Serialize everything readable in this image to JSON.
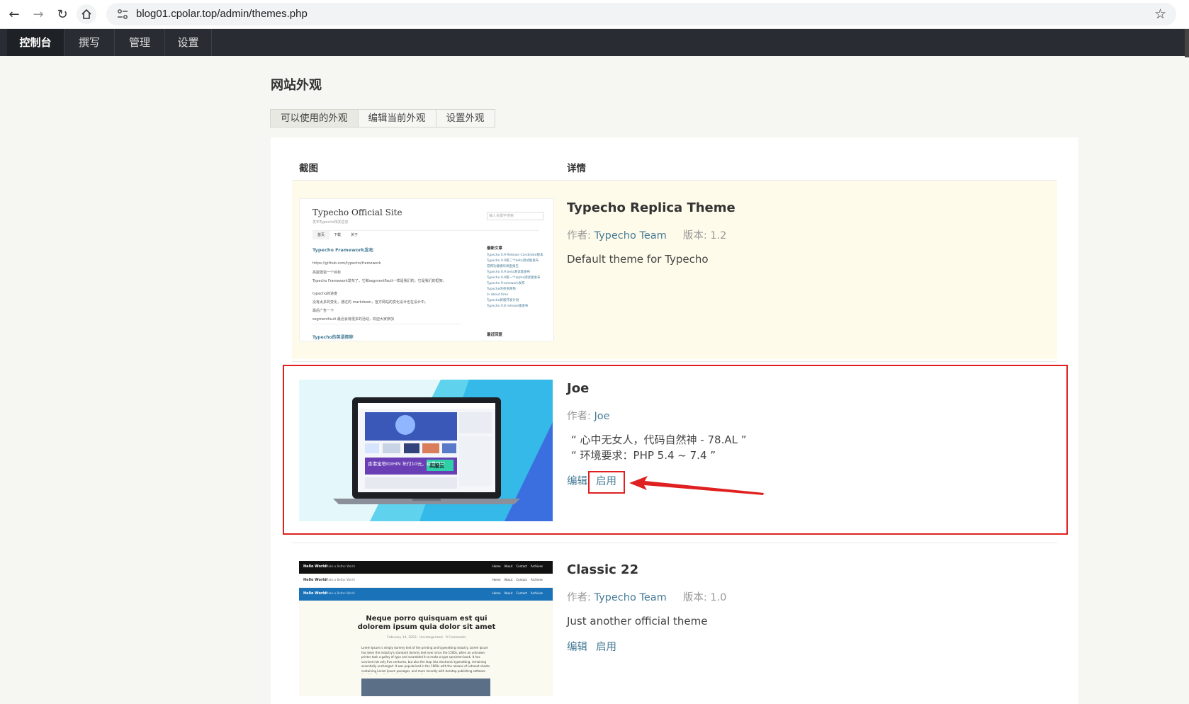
{
  "browser": {
    "url": "blog01.cpolar.top/admin/themes.php"
  },
  "admin_menu": {
    "items": [
      {
        "label": "控制台",
        "active": true
      },
      {
        "label": "撰写",
        "active": false
      },
      {
        "label": "管理",
        "active": false
      },
      {
        "label": "设置",
        "active": false
      }
    ]
  },
  "page": {
    "title": "网站外观",
    "tabs": [
      {
        "label": "可以使用的外观",
        "active": true
      },
      {
        "label": "编辑当前外观",
        "active": false
      },
      {
        "label": "设置外观",
        "active": false
      }
    ]
  },
  "table": {
    "col_screenshot": "截图",
    "col_details": "详情",
    "author_prefix": "作者: ",
    "version_prefix": "版本: ",
    "edit_label": "编辑",
    "enable_label": "启用",
    "themes": [
      {
        "name": "Typecho Replica Theme",
        "author": "Typecho Team",
        "version": "1.2",
        "description": "Default theme for Typecho",
        "current": true
      },
      {
        "name": "Joe",
        "author": "Joe",
        "description_line1": "“ 心中无女人，代码自然神 - 78.AL ”",
        "description_line2": "“ 环境要求：PHP 5.4 ~ 7.4 ”"
      },
      {
        "name": "Classic 22",
        "author": "Typecho Team",
        "version": "1.0",
        "description": "Just another official theme"
      }
    ]
  },
  "thumbnails": {
    "typecho": {
      "site_title": "Typecho Official Site",
      "subtitle": "发布Typecho相关信息",
      "search_placeholder": "输入关键字搜索",
      "nav": [
        "首页",
        "下载",
        "关于"
      ],
      "post_title": "Typecho Framework发布",
      "post_url": "https://github.com/typecho/framework",
      "post_line1": "高屋建瓴一个目标",
      "post_line2": "Typecho Framework发布了，它和segmentFault一样是我们的，它是我们的框架。",
      "post_line3": "typecho的进度",
      "post_line4": "没有太多的变化，通过的 markdown，官方网站的变化设计也在设计中。",
      "post_line5": "最后广告一下",
      "post_line6": "segmentfault 最近会有很多的活动，欢迎大家参加",
      "post_title2": "Typecho的英语简称",
      "sidebar_title": "最新文章",
      "sidebar_items": [
        "Typecho 0.9 Release Candidate版本发布",
        "Typecho 0.9第二个beta测试版发布",
        "官网功能模块调查报告",
        "Typecho 0.9 beta测试版发布",
        "Typecho 0.9第一个alpha测试版发布",
        "Typecho Framework发布",
        "Typecho的英语简称",
        "In about time",
        "Typecho新版开发计划",
        "Typecho 0.8 release版发布"
      ],
      "sidebar_title2": "最近回复"
    },
    "joe": {
      "banner_text": "香港宝塔IGIHIN 年付10元，续费同价",
      "banner_button": "买服云"
    },
    "classic": {
      "brand": "Hello World",
      "tagline": "Make a Better World",
      "nav": [
        "Home",
        "About",
        "Contact",
        "Archives"
      ],
      "post_title": "Neque porro quisquam est qui dolorem ipsum quia dolor sit amet",
      "post_meta": "February 14, 2023 · Uncategorized · 0 Comments",
      "post_body": "Lorem Ipsum is simply dummy text of the printing and typesetting industry. Lorem Ipsum has been the industry's standard dummy text ever since the 1500s, when an unknown printer took a galley of type and scrambled it to make a type specimen book. It has survived not only five centuries, but also the leap into electronic typesetting, remaining essentially unchanged. It was popularised in the 1960s with the release of Letraset sheets containing Lorem Ipsum passages, and more recently with desktop publishing software like Aldus PageMaker including versions of Lorem Ipsum."
    }
  }
}
